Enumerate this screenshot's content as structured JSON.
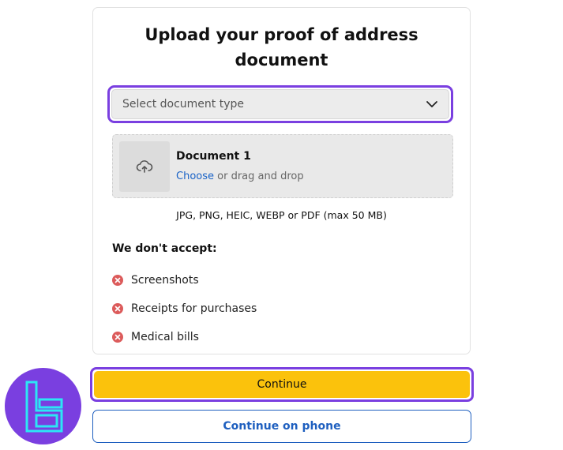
{
  "title_line1": "Upload your proof of address",
  "title_line2": "document",
  "document_type_select": {
    "placeholder": "Select document type",
    "icon": "chevron-down-icon"
  },
  "dropzone": {
    "icon": "upload-cloud-icon",
    "title": "Document 1",
    "choose_link": "Choose",
    "drag_text": "or drag and drop"
  },
  "formats_note": "JPG, PNG, HEIC, WEBP or PDF (max 50 MB)",
  "not_accepted": {
    "heading": "We don't accept:",
    "items": [
      "Screenshots",
      "Receipts for purchases",
      "Medical bills"
    ],
    "icon": "x-circle-icon"
  },
  "buttons": {
    "continue": "Continue",
    "continue_on_phone": "Continue on phone"
  },
  "colors": {
    "highlight_border": "#7a3fe0",
    "primary_button": "#fbc20c",
    "link": "#1a63c7",
    "reject_icon": "#dc5b5b",
    "logo_bg": "#7a3fe0",
    "logo_mark": "#2ce6f5"
  }
}
